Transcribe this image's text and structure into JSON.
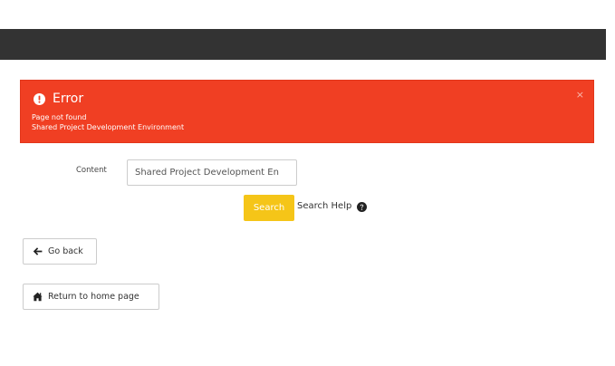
{
  "alert": {
    "title": "Error",
    "message": "Page not found",
    "detail": "Shared Project Development Environment",
    "close_label": "×",
    "background": "#f03f23"
  },
  "form": {
    "content_label": "Content",
    "content_value": "Shared Project Development En",
    "search_label": "Search",
    "search_help_label": "Search Help"
  },
  "nav": {
    "go_back_label": "Go back",
    "home_label": "Return to home page"
  },
  "colors": {
    "top_bar": "#333333",
    "search_button": "#f5c518"
  },
  "icons": {
    "alert": "exclamation-circle-icon",
    "help": "question-circle-icon",
    "back": "arrow-left-icon",
    "home": "home-icon"
  }
}
